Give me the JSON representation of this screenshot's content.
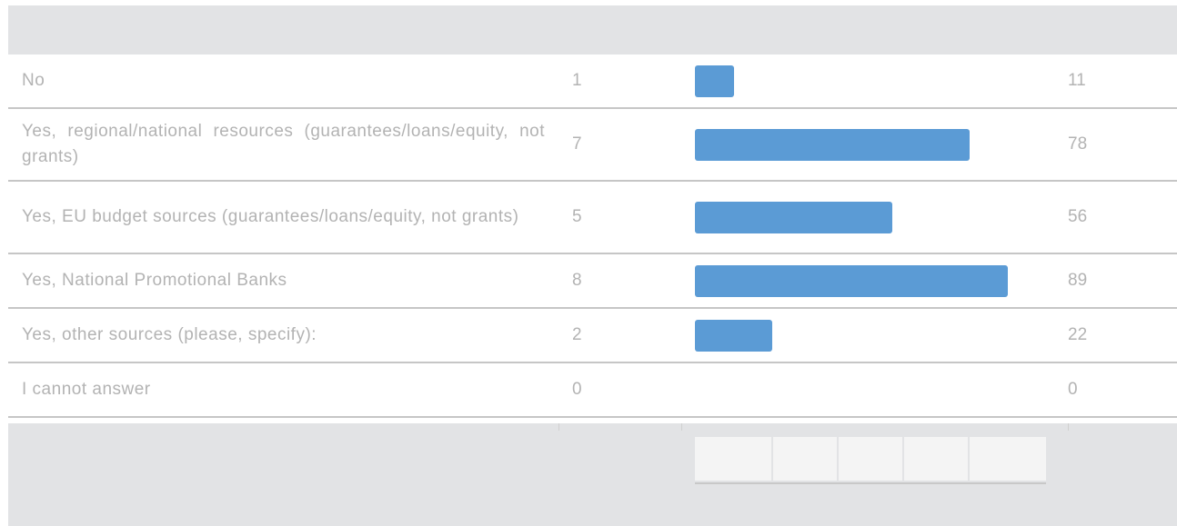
{
  "chart_data": {
    "type": "bar",
    "orientation": "horizontal",
    "categories": [
      "No",
      "Yes, regional/national resources (guarantees/loans/equity, not grants)",
      "Yes, EU budget sources (guarantees/loans/equity, not grants)",
      "Yes, National Promotional Banks",
      "Yes, other sources (please, specify):",
      "I cannot answer"
    ],
    "counts": [
      "1",
      "7",
      "5",
      "8",
      "2",
      "0"
    ],
    "values": [
      11,
      78,
      56,
      89,
      22,
      0
    ],
    "percent_labels": [
      "11",
      "78",
      "56",
      "89",
      "22",
      "0"
    ],
    "xlim": [
      0,
      100
    ],
    "bar_color": "#5b9bd5"
  }
}
